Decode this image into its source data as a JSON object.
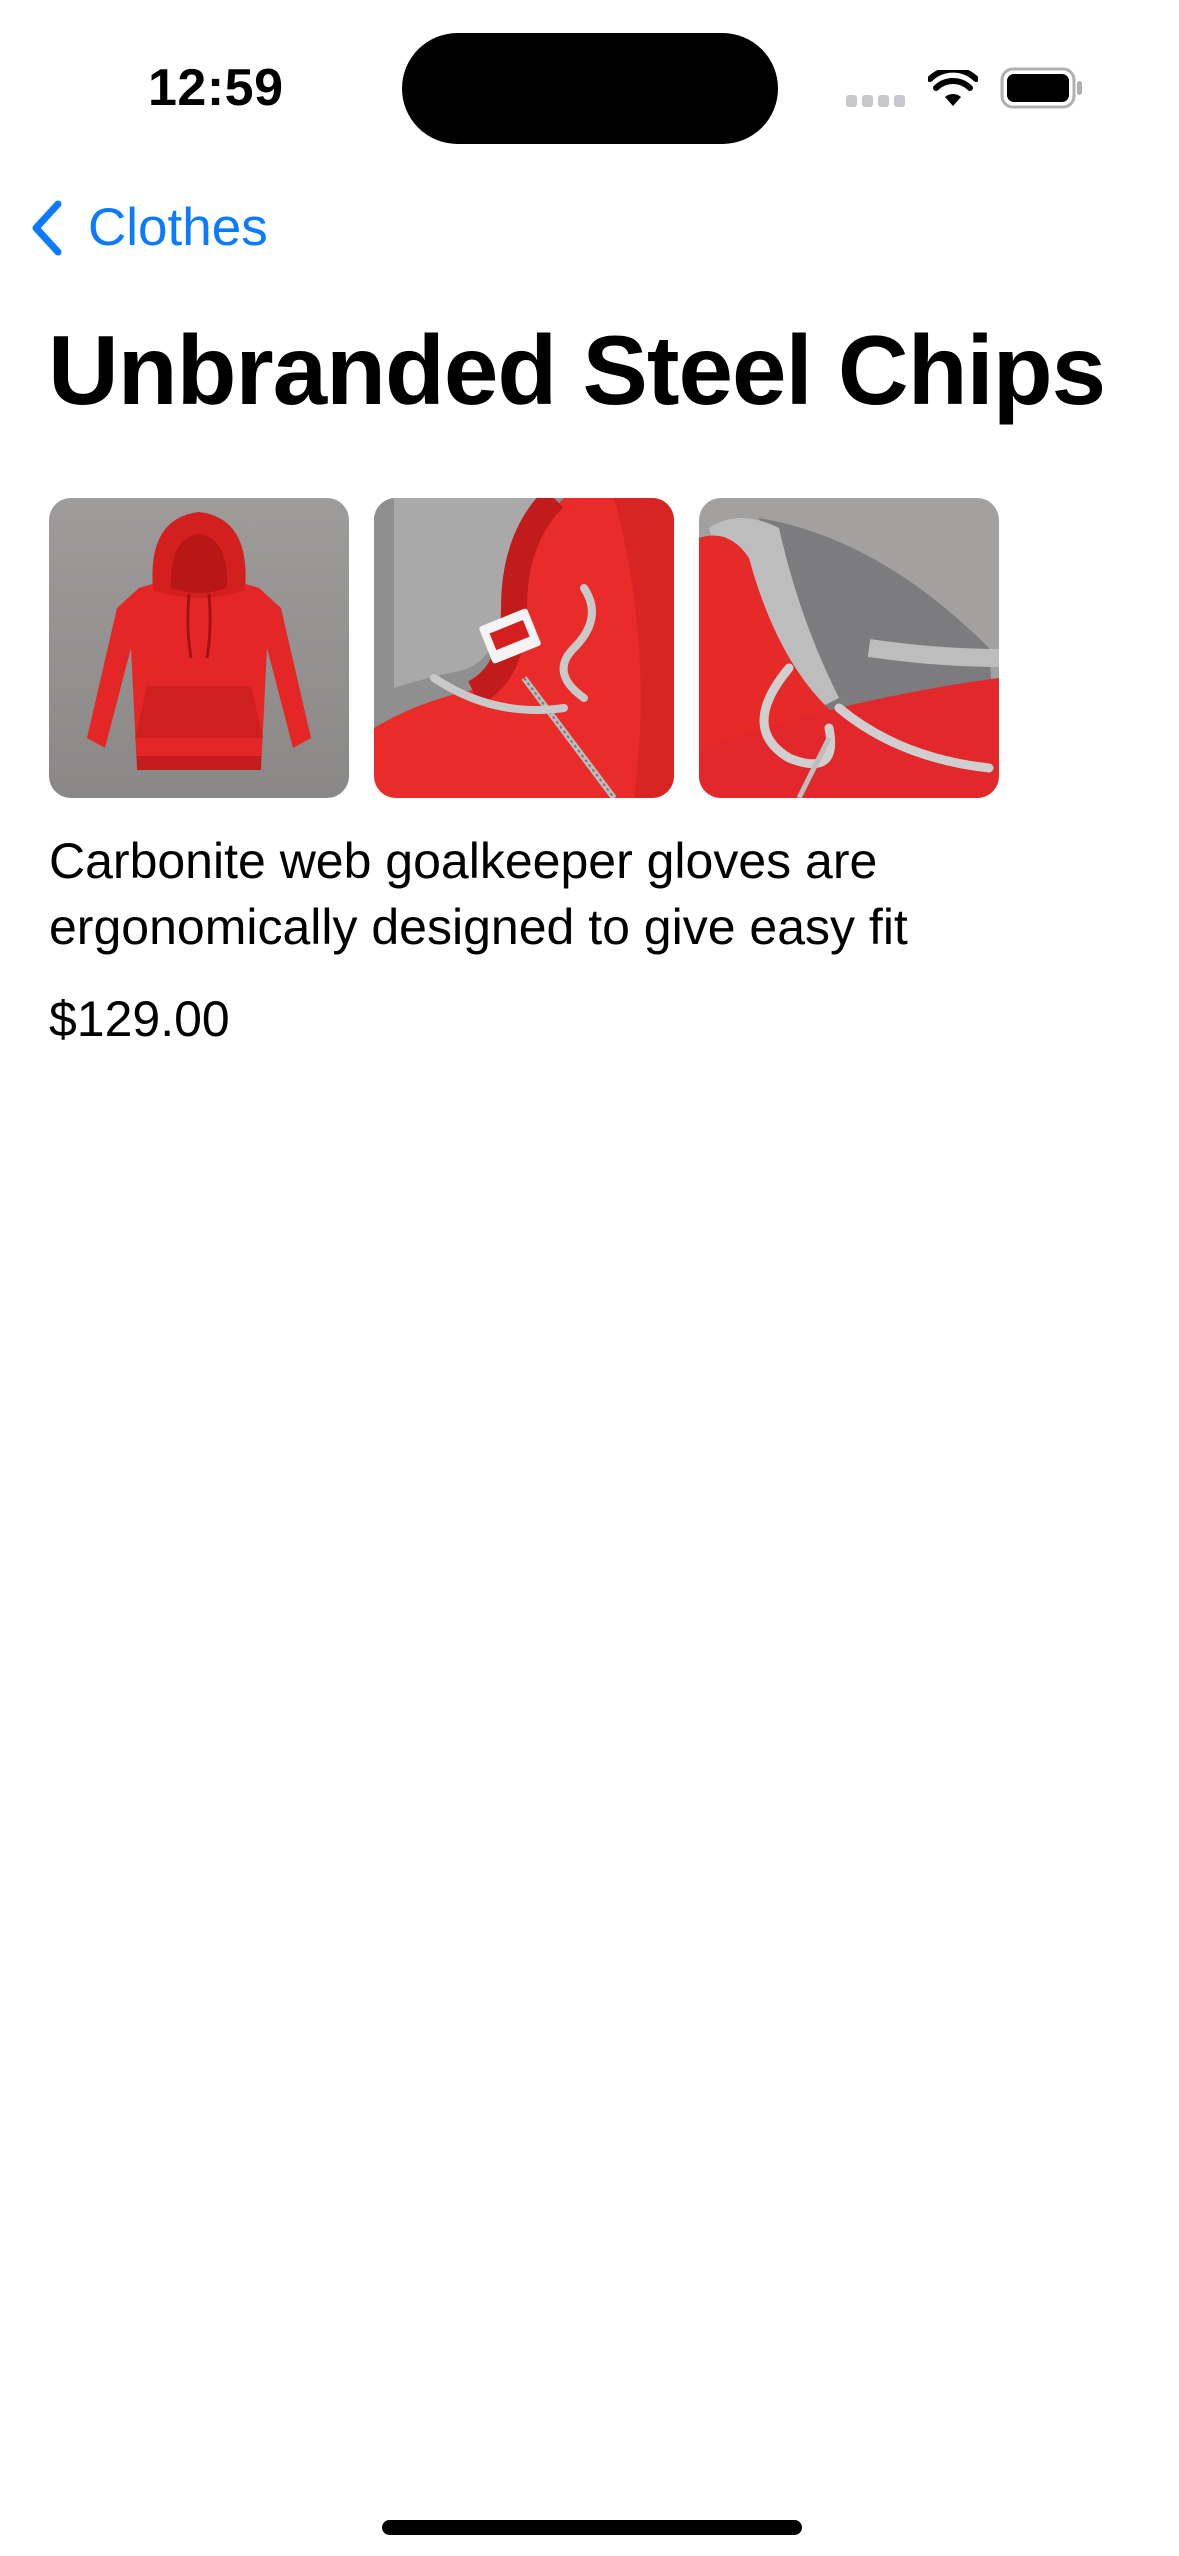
{
  "status_bar": {
    "time": "12:59",
    "icons": [
      "signal-icon",
      "wifi-icon",
      "battery-icon"
    ]
  },
  "nav": {
    "back_label": "Clothes",
    "back_icon": "chevron-left-icon",
    "accent_color": "#0A7AFF"
  },
  "product": {
    "title": "Unbranded Steel Chips",
    "images": [
      {
        "alt": "Red hoodie front view"
      },
      {
        "alt": "Red hoodie collar close-up"
      },
      {
        "alt": "Red hoodie hood detail"
      }
    ],
    "description": "Carbonite web goalkeeper gloves are ergonomically designed to give easy fit",
    "price": "$129.00"
  }
}
